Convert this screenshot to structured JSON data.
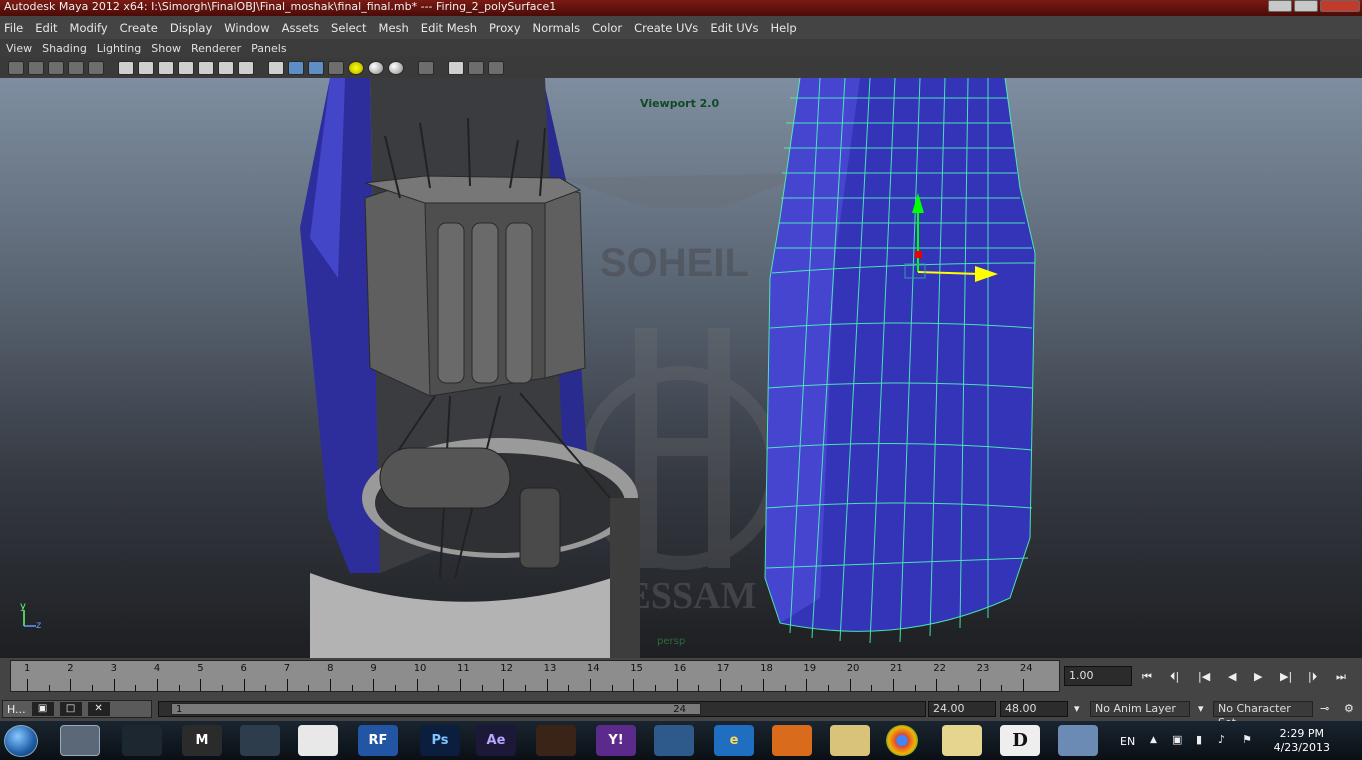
{
  "window": {
    "title": "Autodesk Maya 2012 x64: I:\\Simorgh\\FinalOBJ\\Final_moshak\\final_final.mb*   ---   Firing_2_polySurface1"
  },
  "main_menu": [
    "File",
    "Edit",
    "Modify",
    "Create",
    "Display",
    "Window",
    "Assets",
    "Select",
    "Mesh",
    "Edit Mesh",
    "Proxy",
    "Normals",
    "Color",
    "Create UVs",
    "Edit UVs",
    "Help"
  ],
  "panel_menu": [
    "View",
    "Shading",
    "Lighting",
    "Show",
    "Renderer",
    "Panels"
  ],
  "viewport": {
    "renderer_label": "Viewport 2.0",
    "camera_label": "persp",
    "axis_y": "y",
    "axis_z": "z",
    "watermark_top": "SOHEIL",
    "watermark_bottom": "HESSAM"
  },
  "timeline": {
    "ticks": [
      "1",
      "2",
      "3",
      "4",
      "5",
      "6",
      "7",
      "8",
      "9",
      "10",
      "11",
      "12",
      "13",
      "14",
      "15",
      "16",
      "17",
      "18",
      "19",
      "20",
      "21",
      "22",
      "23",
      "24"
    ],
    "current_frame": "1.00"
  },
  "range": {
    "start": "1",
    "end": "24",
    "anim_end": "24.00",
    "playback_end": "48.00",
    "anim_layer": "No Anim Layer",
    "character_set": "No Character Set"
  },
  "minimized_panel": {
    "label": "H..."
  },
  "taskbar": {
    "apps": [
      {
        "name": "maya",
        "label": ""
      },
      {
        "name": "3dsmax",
        "label": ""
      },
      {
        "name": "mudbox",
        "label": "M"
      },
      {
        "name": "dolphin",
        "label": ""
      },
      {
        "name": "zbrush",
        "label": ""
      },
      {
        "name": "realflow",
        "label": "RF"
      },
      {
        "name": "photoshop",
        "label": "Ps"
      },
      {
        "name": "aftereffects",
        "label": "Ae"
      },
      {
        "name": "app-dots",
        "label": ""
      },
      {
        "name": "yahoo",
        "label": "Y!"
      },
      {
        "name": "network",
        "label": ""
      },
      {
        "name": "ie",
        "label": "e"
      },
      {
        "name": "media",
        "label": ""
      },
      {
        "name": "explorer",
        "label": ""
      },
      {
        "name": "chrome",
        "label": ""
      },
      {
        "name": "folder",
        "label": ""
      },
      {
        "name": "daemon",
        "label": "D"
      },
      {
        "name": "paint",
        "label": ""
      }
    ],
    "language": "EN",
    "time": "2:29 PM",
    "date": "4/23/2013"
  }
}
